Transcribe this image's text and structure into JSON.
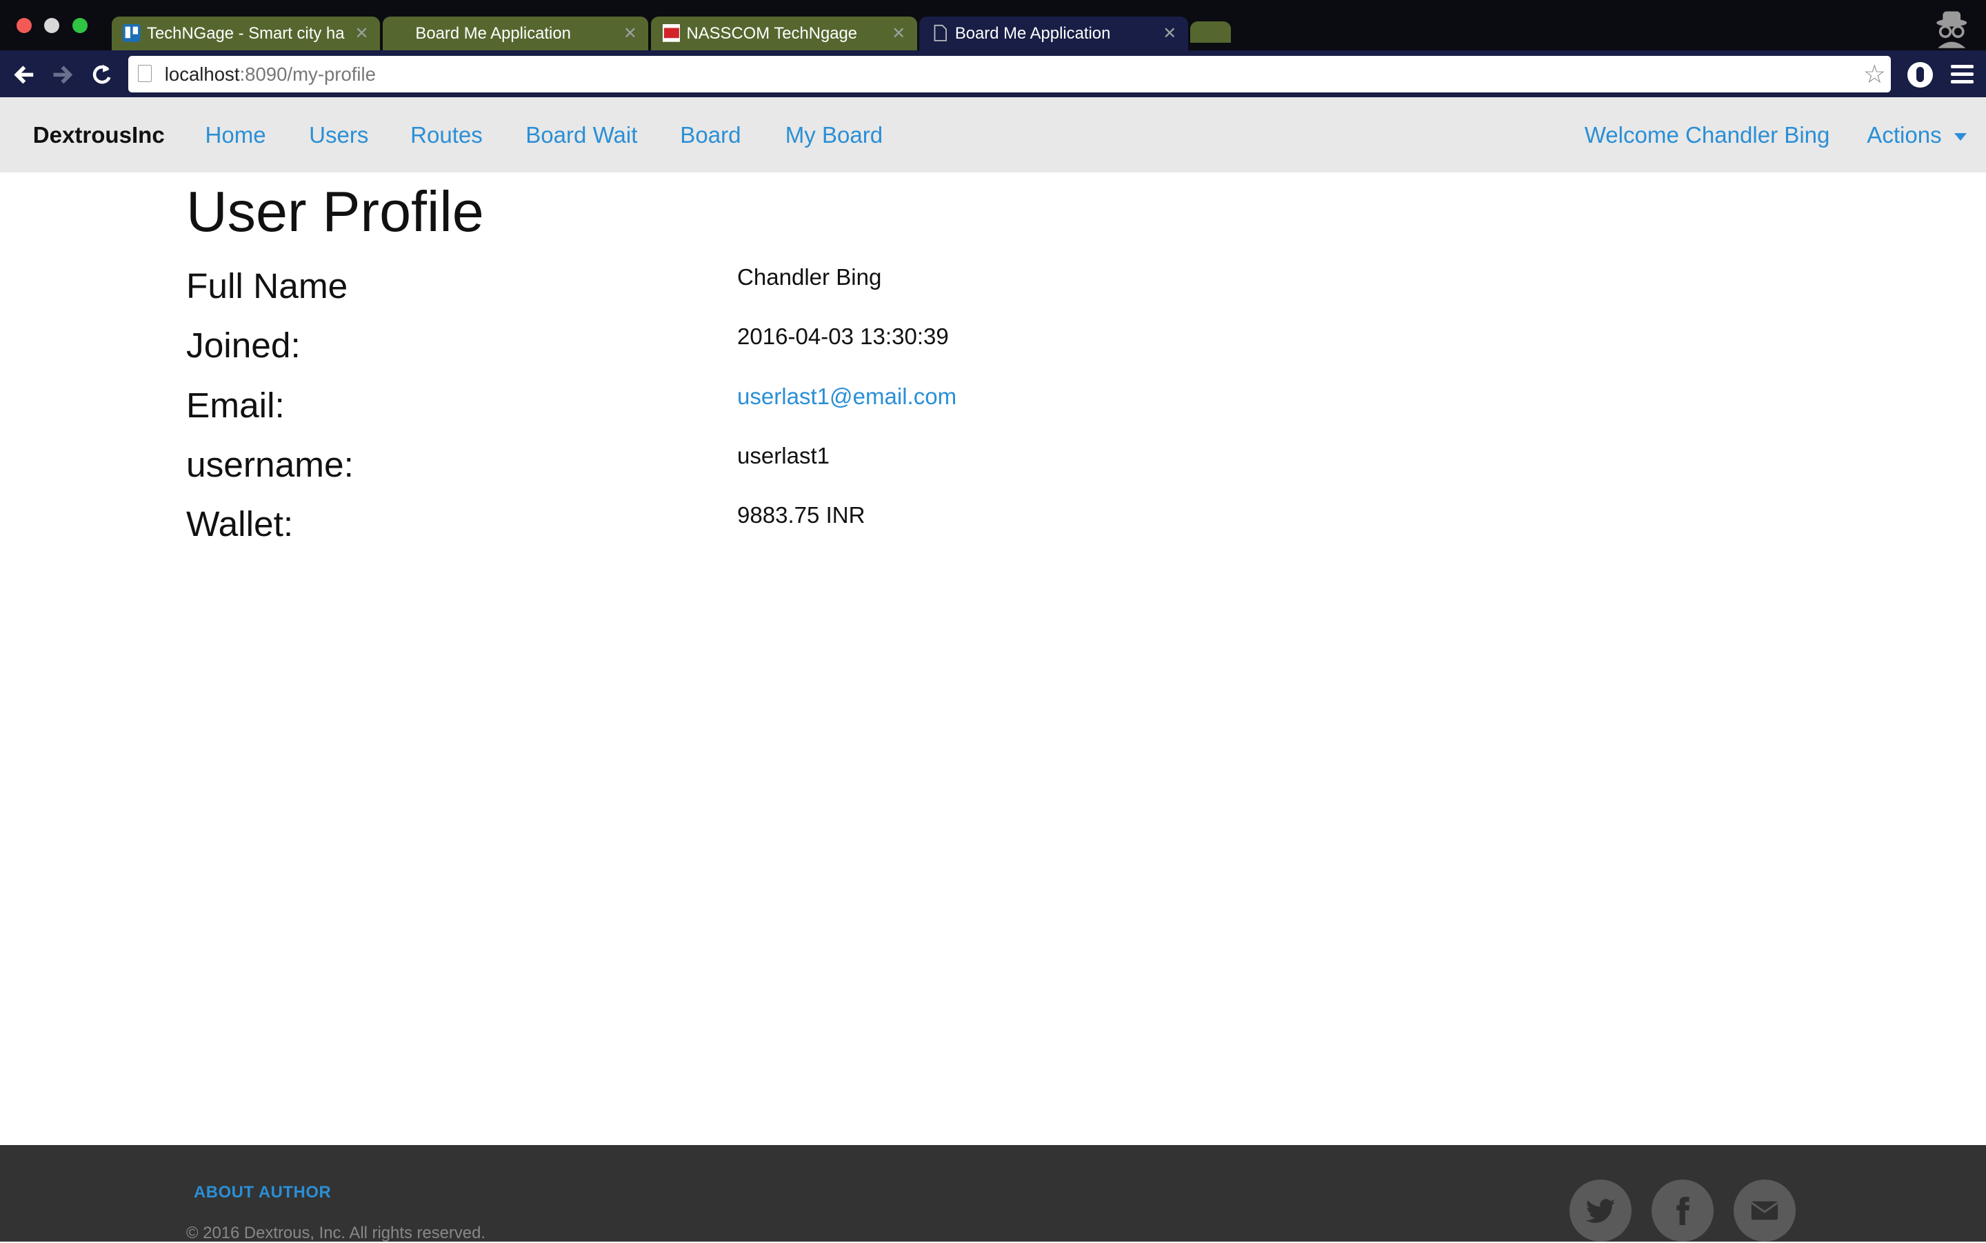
{
  "browser": {
    "tabs": [
      {
        "title": "TechNGage - Smart city ha",
        "active": false
      },
      {
        "title": "Board Me Application",
        "active": false
      },
      {
        "title": "NASSCOM TechNgage",
        "active": false
      },
      {
        "title": "Board Me Application",
        "active": true
      }
    ],
    "url_host": "localhost",
    "url_path": ":8090/my-profile"
  },
  "nav": {
    "brand": "DextrousInc",
    "links": [
      "Home",
      "Users",
      "Routes",
      "Board Wait",
      "Board",
      "My Board"
    ],
    "welcome": "Welcome Chandler Bing",
    "actions": "Actions"
  },
  "profile": {
    "title": "User Profile",
    "rows": [
      {
        "label": "Full Name",
        "value": "Chandler Bing"
      },
      {
        "label": "Joined:",
        "value": "2016-04-03 13:30:39"
      },
      {
        "label": "Email:",
        "value": "userlast1@email.com"
      },
      {
        "label": "username:",
        "value": "userlast1"
      },
      {
        "label": "Wallet:",
        "value": "9883.75 INR"
      }
    ]
  },
  "footer": {
    "about": "ABOUT AUTHOR",
    "copyright": "© 2016 Dextrous, Inc. All rights reserved."
  },
  "colors": {
    "link": "#2a8fd6",
    "navbar_bg": "#e8e8e8",
    "footer_bg": "#333333",
    "browser_toolbar": "#181e45"
  }
}
